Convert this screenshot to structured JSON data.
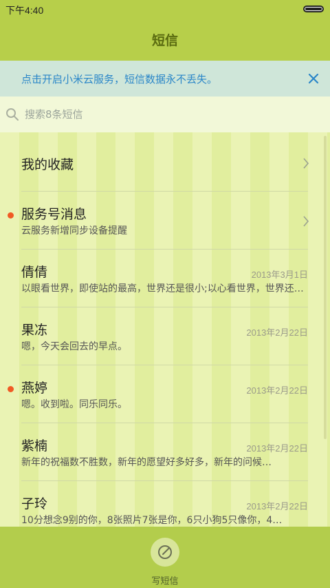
{
  "status_bar": {
    "time": "下午4:40",
    "battery_level": 1.0
  },
  "header": {
    "title": "短信"
  },
  "banner": {
    "text": "点击开启小米云服务，短信数据永不丢失。"
  },
  "search": {
    "placeholder": "搜索8条短信"
  },
  "favorites": {
    "label": "我的收藏"
  },
  "service": {
    "name": "服务号消息",
    "preview": "云服务新增同步设备提醒",
    "unread": true
  },
  "messages": [
    {
      "name": "倩倩",
      "preview": "以眼看世界，即使站的最高，世界还是很小;以心看世界，世界还是很大…",
      "date": "2013年3月1日",
      "unread": false
    },
    {
      "name": "果冻",
      "preview": "嗯，今天会回去的早点。",
      "date": "2013年2月22日",
      "unread": false
    },
    {
      "name": "燕婷",
      "preview": "嗯。收到啦。同乐同乐。",
      "date": "2013年2月22日",
      "unread": true
    },
    {
      "name": "紫楠",
      "preview": "新年的祝福数不胜数，新年的愿望好多好多，新年的问候…",
      "date": "2013年2月22日",
      "unread": false
    },
    {
      "name": "子玲",
      "preview": "10分想念9别的你，8张照片7张是你，6只小狗5只像你，4…",
      "date": "2013年2月22日",
      "unread": false
    }
  ],
  "bottom_bar": {
    "compose_label": "写短信"
  },
  "colors": {
    "accent": "#b7cf4a",
    "unread_dot": "#f05a24",
    "banner_text": "#2a86c8"
  },
  "icons": {
    "close": "close-icon",
    "search": "search-icon",
    "chevron": "chevron-right-icon",
    "compose": "compose-icon"
  }
}
